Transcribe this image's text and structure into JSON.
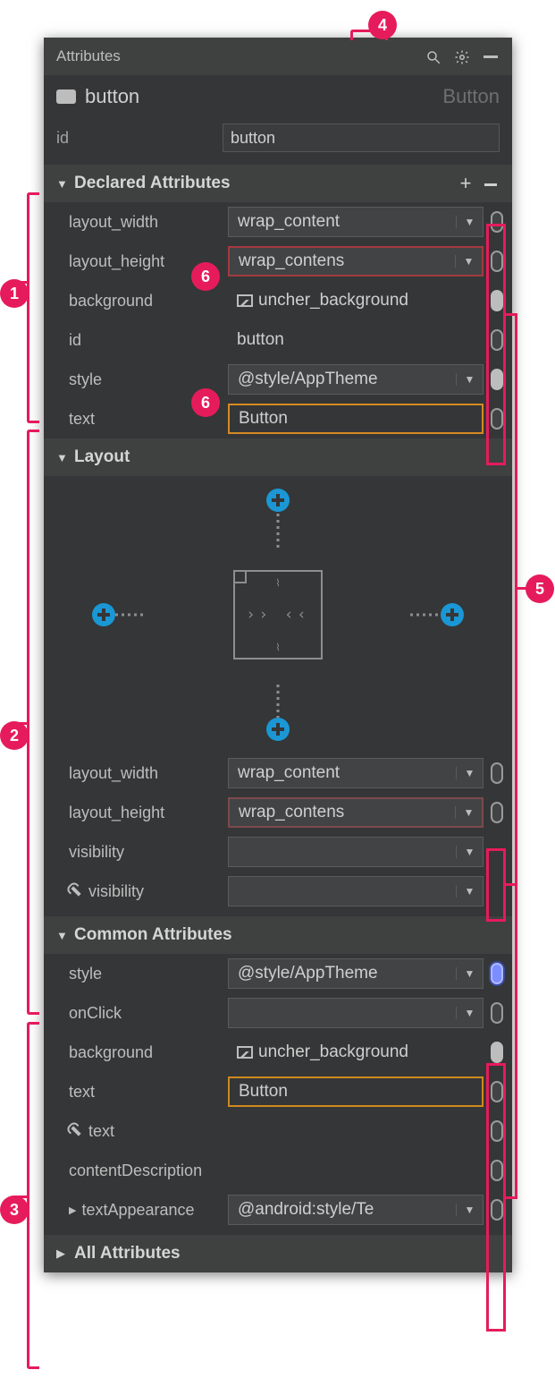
{
  "header": {
    "title": "Attributes"
  },
  "component": {
    "name": "button",
    "type": "Button"
  },
  "idRow": {
    "label": "id",
    "value": "button"
  },
  "sections": {
    "declared": {
      "title": "Declared Attributes"
    },
    "layout": {
      "title": "Layout"
    },
    "common": {
      "title": "Common Attributes"
    },
    "all": {
      "title": "All Attributes"
    }
  },
  "declared": [
    {
      "label": "layout_width",
      "value": "wrap_content",
      "kind": "select",
      "pill": "empty"
    },
    {
      "label": "layout_height",
      "value": "wrap_contens",
      "kind": "select",
      "pill": "empty",
      "error": "red"
    },
    {
      "label": "background",
      "value": "uncher_background",
      "kind": "text",
      "pill": "full",
      "icon": "image"
    },
    {
      "label": "id",
      "value": "button",
      "kind": "text",
      "pill": "empty"
    },
    {
      "label": "style",
      "value": "@style/AppTheme",
      "kind": "select",
      "pill": "full"
    },
    {
      "label": "text",
      "value": "Button",
      "kind": "text",
      "pill": "empty",
      "error": "orange"
    }
  ],
  "layoutAttrs": [
    {
      "label": "layout_width",
      "value": "wrap_content",
      "kind": "select",
      "pill": "empty"
    },
    {
      "label": "layout_height",
      "value": "wrap_contens",
      "kind": "select",
      "pill": "empty",
      "error": "redfade"
    },
    {
      "label": "visibility",
      "value": "",
      "kind": "select"
    },
    {
      "label": "visibility",
      "value": "",
      "kind": "select",
      "tool": true
    }
  ],
  "common": [
    {
      "label": "style",
      "value": "@style/AppTheme",
      "kind": "select",
      "pill": "hi"
    },
    {
      "label": "onClick",
      "value": "",
      "kind": "select",
      "pill": "empty"
    },
    {
      "label": "background",
      "value": "uncher_background",
      "kind": "text",
      "pill": "full",
      "icon": "image"
    },
    {
      "label": "text",
      "value": "Button",
      "kind": "text",
      "pill": "empty",
      "error": "orange2"
    },
    {
      "label": "text",
      "value": "",
      "kind": "text",
      "pill": "empty",
      "tool": true
    },
    {
      "label": "contentDescription",
      "value": "",
      "kind": "text",
      "pill": "empty"
    },
    {
      "label": "textAppearance",
      "value": "@android:style/Te",
      "kind": "select",
      "pill": "empty",
      "expand": true
    }
  ],
  "callouts": {
    "1": "1",
    "2": "2",
    "3": "3",
    "4": "4",
    "5": "5",
    "6": "6"
  }
}
